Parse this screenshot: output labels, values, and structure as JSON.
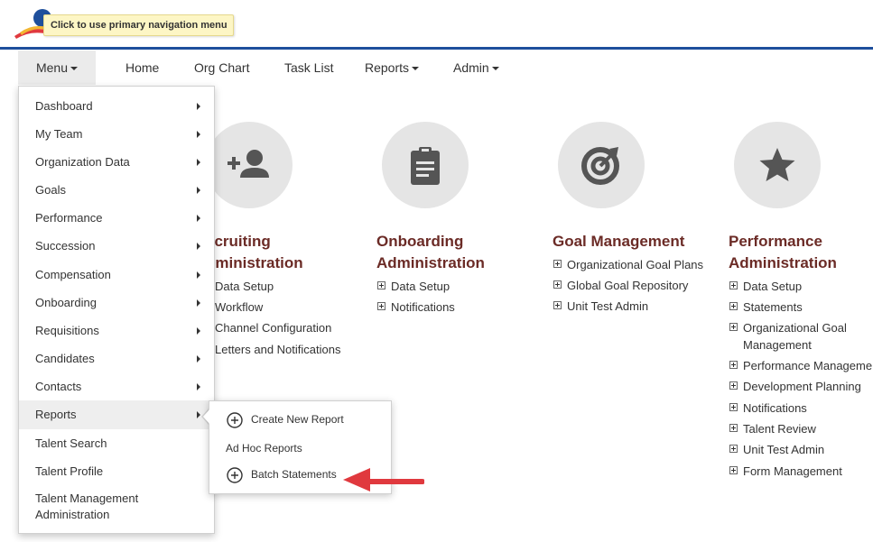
{
  "header": {
    "tooltip": "Click to use primary navigation menu"
  },
  "topnav": {
    "menu": "Menu",
    "home": "Home",
    "org_chart": "Org Chart",
    "task_list": "Task List",
    "reports": "Reports",
    "admin": "Admin"
  },
  "menu": {
    "items": [
      {
        "label": "Dashboard"
      },
      {
        "label": "My Team"
      },
      {
        "label": "Organization Data"
      },
      {
        "label": "Goals"
      },
      {
        "label": "Performance"
      },
      {
        "label": "Succession"
      },
      {
        "label": "Compensation"
      },
      {
        "label": "Onboarding"
      },
      {
        "label": "Requisitions"
      },
      {
        "label": "Candidates"
      },
      {
        "label": "Contacts"
      },
      {
        "label": "Reports"
      },
      {
        "label": "Talent Search"
      },
      {
        "label": "Talent Profile"
      },
      {
        "label": "Talent Management Administration"
      }
    ]
  },
  "submenu": {
    "create_new_report": "Create New Report",
    "ad_hoc_reports": "Ad Hoc Reports",
    "batch_statements": "Batch Statements"
  },
  "tiles": {
    "recruiting": {
      "title_line1": "ecruiting",
      "title_line2": "dministration",
      "links": [
        "Data Setup",
        "Workflow",
        "Channel Configuration",
        "Letters and Notifications"
      ]
    },
    "onboarding": {
      "title_line1": "Onboarding",
      "title_line2": "Administration",
      "links": [
        "Data Setup",
        "Notifications"
      ]
    },
    "goal": {
      "title_line1": "Goal Management",
      "links": [
        "Organizational Goal Plans",
        "Global Goal Repository",
        "Unit Test Admin"
      ]
    },
    "performance": {
      "title_line1": "Performance",
      "title_line2": "Administration",
      "links": [
        "Data Setup",
        "Statements",
        "Organizational Goal",
        "Management",
        "Performance Managemen",
        "Development Planning",
        "Notifications",
        "Talent Review",
        "Unit Test Admin",
        "Form Management"
      ]
    }
  },
  "colors": {
    "brand_blue": "#1e4f9c",
    "tile_title": "#6b2b26",
    "tile_bg": "#e5e5e5",
    "icon_gray": "#555555",
    "arrow_red": "#e0393e"
  }
}
